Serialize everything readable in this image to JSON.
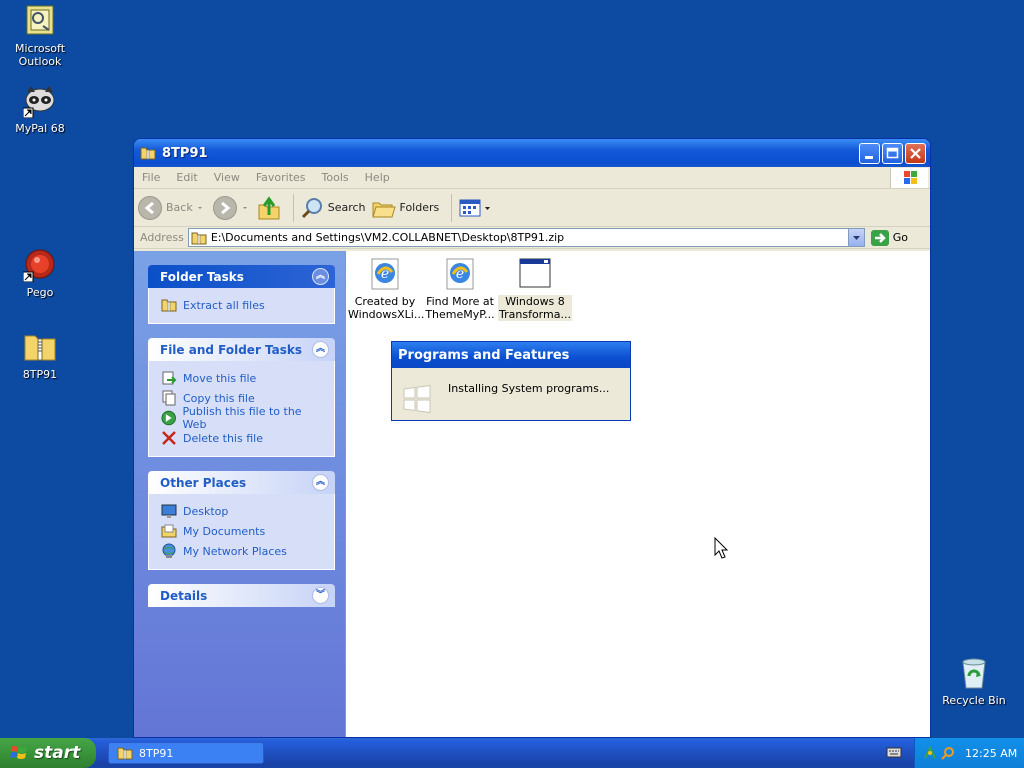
{
  "desktop": {
    "icons": [
      {
        "label_line1": "Microsoft",
        "label_line2": "Outlook",
        "icon": "outlook-icon"
      },
      {
        "label_line1": "MyPal 68",
        "label_line2": "",
        "icon": "mypal-icon"
      },
      {
        "label_line1": "Pego",
        "label_line2": "",
        "icon": "pego-icon"
      },
      {
        "label_line1": "8TP91",
        "label_line2": "",
        "icon": "zip-folder-icon"
      },
      {
        "label_line1": "Recycle Bin",
        "label_line2": "",
        "icon": "recycle-bin-icon"
      }
    ]
  },
  "window": {
    "title": "8TP91",
    "menu": [
      "File",
      "Edit",
      "View",
      "Favorites",
      "Tools",
      "Help"
    ],
    "toolbar": {
      "back": "Back",
      "search": "Search",
      "folders": "Folders"
    },
    "address": {
      "label": "Address",
      "value": "E:\\Documents and Settings\\VM2.COLLABNET\\Desktop\\8TP91.zip",
      "go": "Go"
    },
    "panels": [
      {
        "title": "Folder Tasks",
        "links": [
          "Extract all files"
        ]
      },
      {
        "title": "File and Folder Tasks",
        "links": [
          "Move this file",
          "Copy this file",
          "Publish this file to the Web",
          "Delete this file"
        ]
      },
      {
        "title": "Other Places",
        "links": [
          "Desktop",
          "My Documents",
          "My Network Places"
        ]
      },
      {
        "title": "Details",
        "links": []
      }
    ],
    "files": [
      {
        "line1": "Created by",
        "line2": "WindowsXLi..."
      },
      {
        "line1": "Find More at",
        "line2": "ThemeMyP..."
      },
      {
        "line1": "Windows 8",
        "line2": "Transforma..."
      }
    ]
  },
  "dialog": {
    "title": "Programs and Features",
    "message": "Installing System programs..."
  },
  "taskbar": {
    "start": "start",
    "task": "8TP91",
    "clock": "12:25 AM"
  },
  "colors": {
    "desktop": "#0d4aa2",
    "xp_blue": "#0b4fd0",
    "start_green": "#379037",
    "link_blue": "#215dc6"
  }
}
